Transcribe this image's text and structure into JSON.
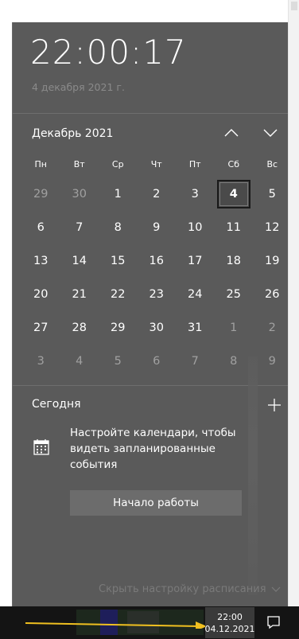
{
  "clock": {
    "time": "22:00:17",
    "date_long": "4 декабря 2021 г."
  },
  "calendar": {
    "month_title": "Декабрь 2021",
    "weekdays": [
      "Пн",
      "Вт",
      "Ср",
      "Чт",
      "Пт",
      "Сб",
      "Вс"
    ],
    "weeks": [
      [
        "29",
        "30",
        "1",
        "2",
        "3",
        "4",
        "5"
      ],
      [
        "6",
        "7",
        "8",
        "9",
        "10",
        "11",
        "12"
      ],
      [
        "13",
        "14",
        "15",
        "16",
        "17",
        "18",
        "19"
      ],
      [
        "20",
        "21",
        "22",
        "23",
        "24",
        "25",
        "26"
      ],
      [
        "27",
        "28",
        "29",
        "30",
        "31",
        "1",
        "2"
      ],
      [
        "3",
        "4",
        "5",
        "6",
        "7",
        "8",
        "9"
      ]
    ],
    "selected_day": "4"
  },
  "agenda": {
    "title": "Сегодня",
    "message": "Настройте календари, чтобы видеть запланированные события",
    "start_button": "Начало работы",
    "hide_link": "Скрыть настройку расписания"
  },
  "taskbar": {
    "time": "22:00",
    "date": "04.12.2021"
  },
  "icons": {
    "prev_month": "chevron-up-icon",
    "next_month": "chevron-down-icon",
    "add_event": "plus-icon",
    "calendar": "calendar-icon",
    "notifications": "action-center-icon",
    "annotation": "arrow-icon"
  },
  "colors": {
    "flyout_bg": "#5a5a5a",
    "taskbar_bg": "#141414",
    "arrow": "#f0c020"
  }
}
